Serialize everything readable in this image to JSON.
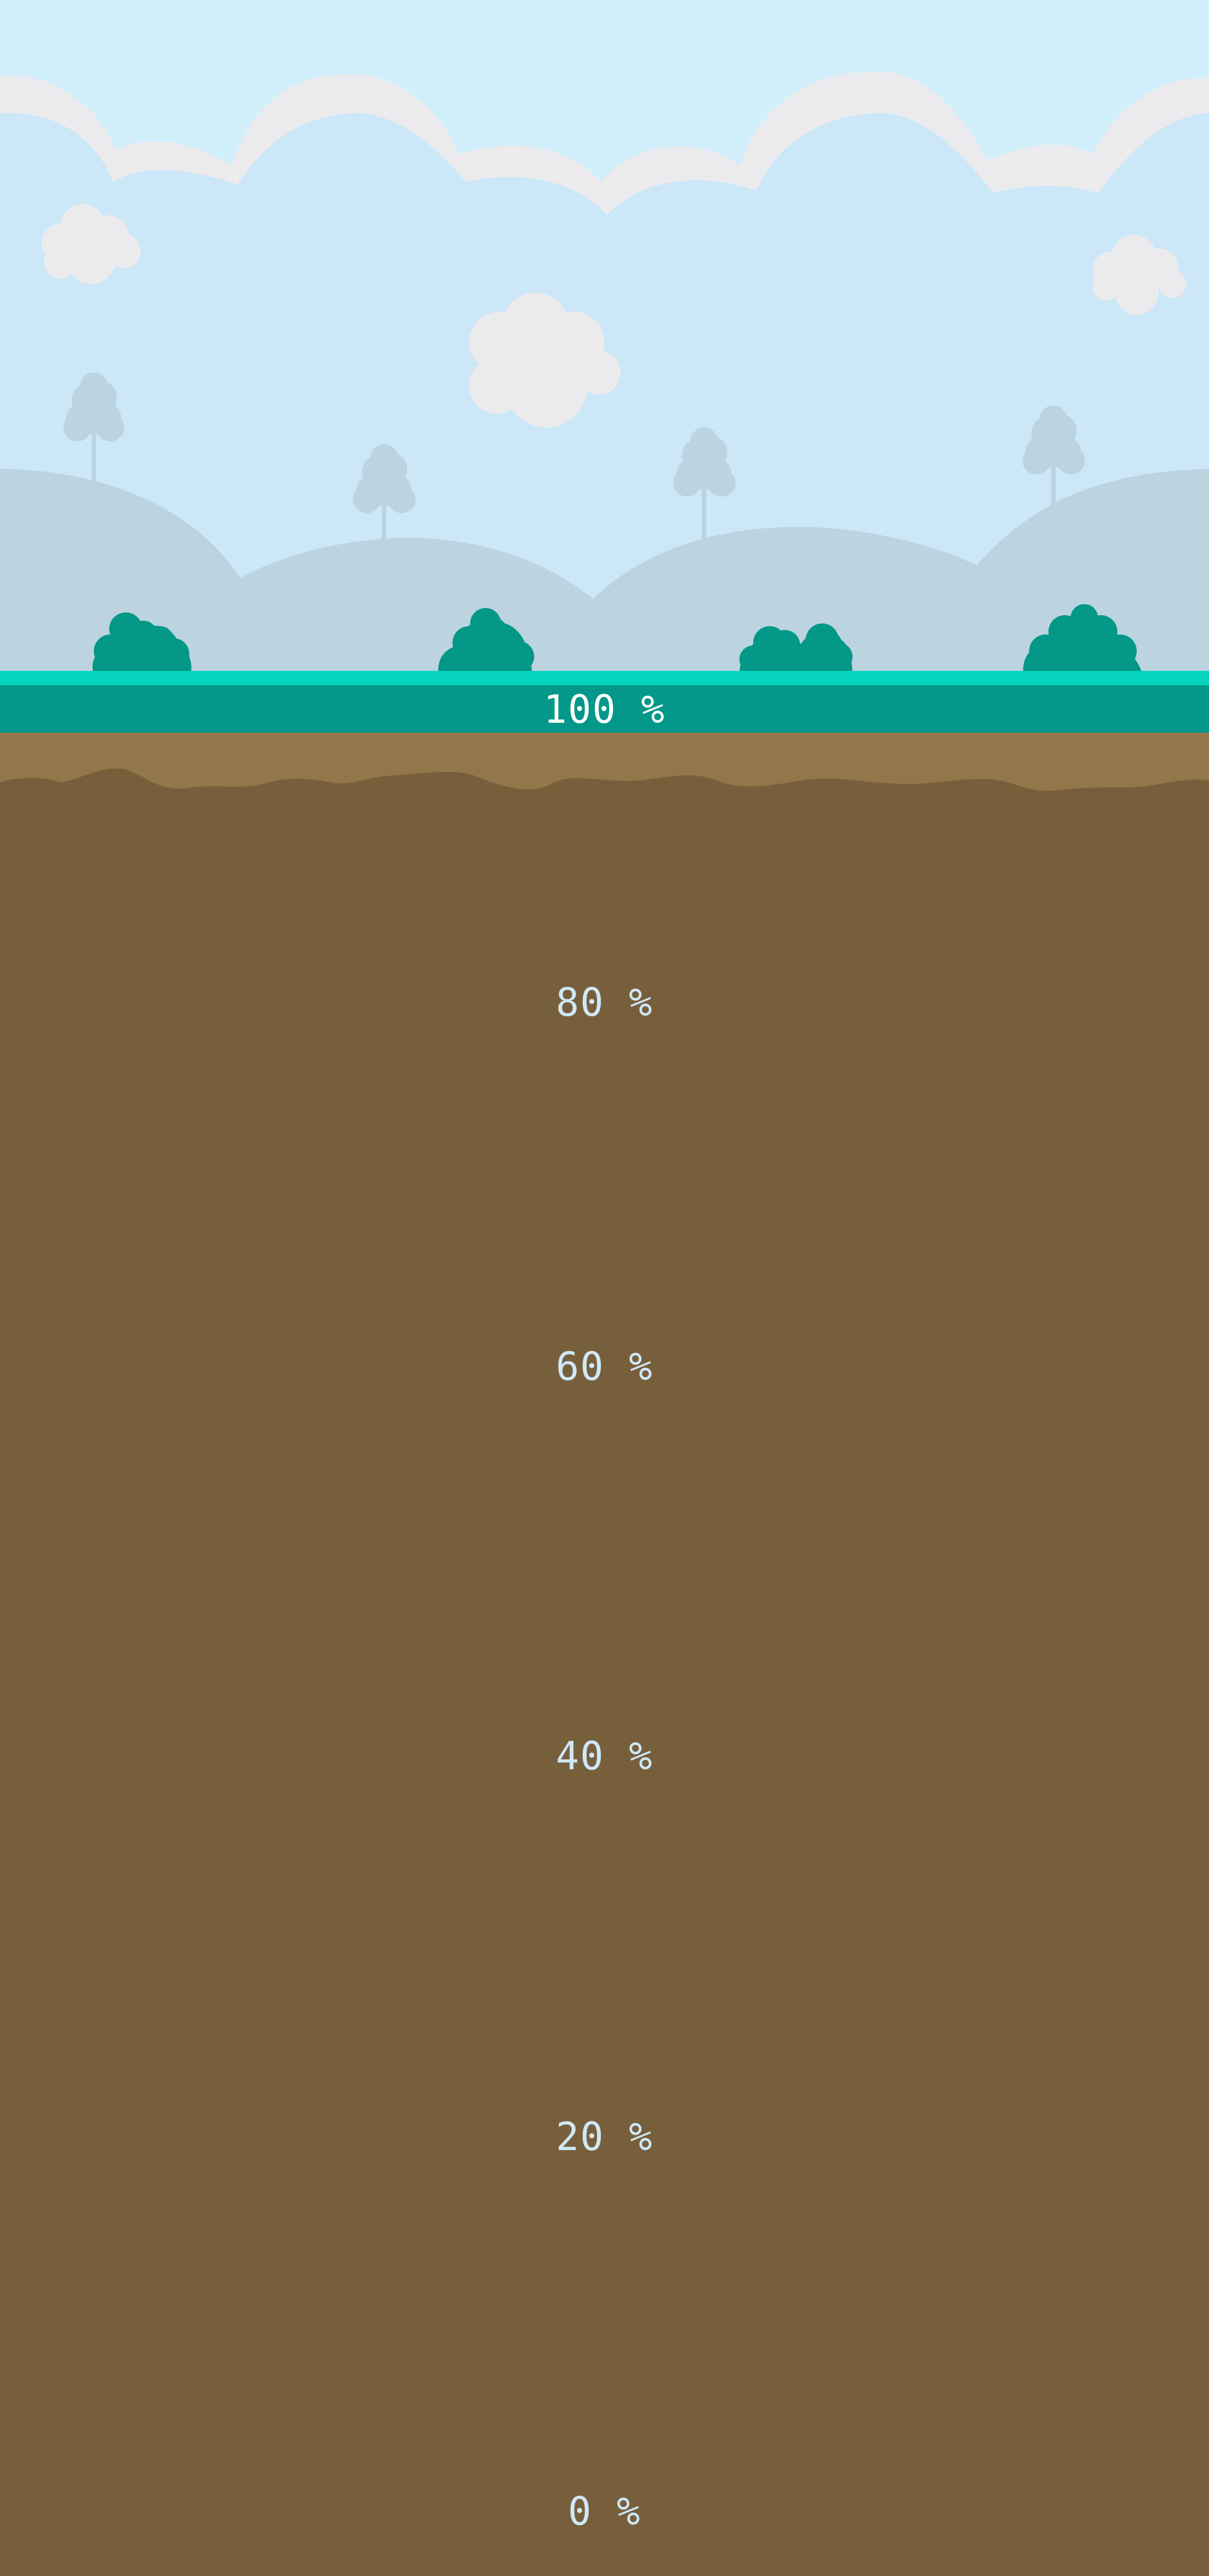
{
  "game": {
    "depth_markers": [
      "100 %",
      "80 %",
      "60 %",
      "40 %",
      "20 %",
      "0 %"
    ]
  },
  "colors": {
    "sky": "#d1eefb",
    "sky_inner": "#cbe7f8",
    "cloud": "#ebebee",
    "hills": "#bcd3e0",
    "bushes": "#049888",
    "grass_highlight": "#06d4bf",
    "grass_band": "#039889",
    "topsoil": "#93774a",
    "soil": "#785f3c",
    "label_text": "#cfe8f6"
  }
}
